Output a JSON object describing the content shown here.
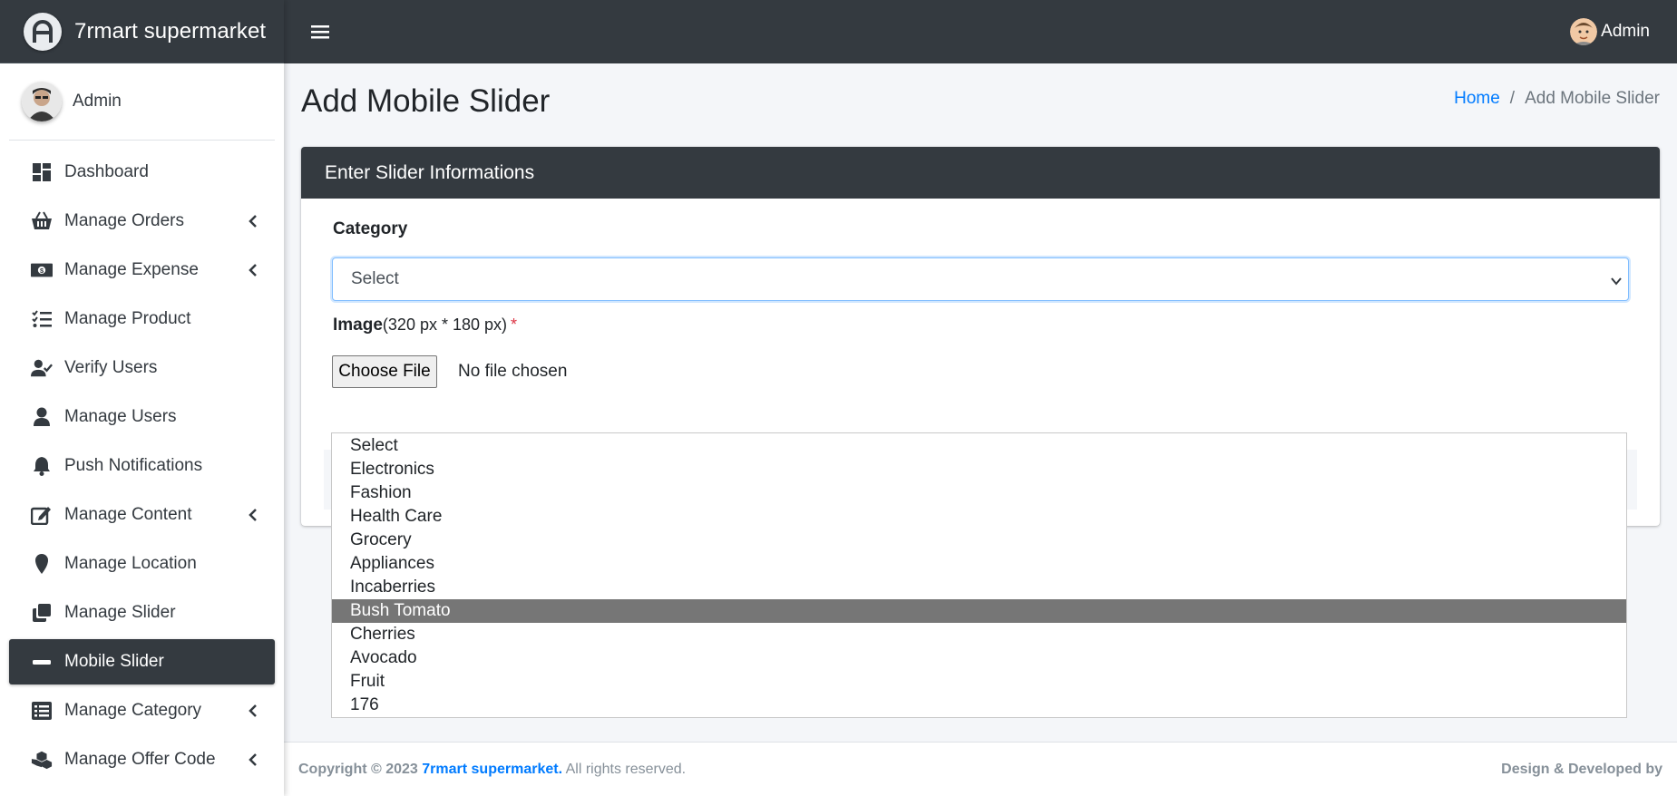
{
  "brand": {
    "name": "7rmart supermarket"
  },
  "sidebar": {
    "user_name": "Admin",
    "items": [
      {
        "label": "Dashboard",
        "icon": "dashboard-icon",
        "has_children": false,
        "active": false
      },
      {
        "label": "Manage Orders",
        "icon": "basket-icon",
        "has_children": true,
        "active": false
      },
      {
        "label": "Manage Expense",
        "icon": "money-icon",
        "has_children": true,
        "active": false
      },
      {
        "label": "Manage Product",
        "icon": "tasks-icon",
        "has_children": false,
        "active": false
      },
      {
        "label": "Verify Users",
        "icon": "user-check-icon",
        "has_children": false,
        "active": false
      },
      {
        "label": "Manage Users",
        "icon": "user-icon",
        "has_children": false,
        "active": false
      },
      {
        "label": "Push Notifications",
        "icon": "bell-icon",
        "has_children": false,
        "active": false
      },
      {
        "label": "Manage Content",
        "icon": "edit-icon",
        "has_children": true,
        "active": false
      },
      {
        "label": "Manage Location",
        "icon": "map-marker-icon",
        "has_children": false,
        "active": false
      },
      {
        "label": "Manage Slider",
        "icon": "clone-icon",
        "has_children": false,
        "active": false
      },
      {
        "label": "Mobile Slider",
        "icon": "minus-icon",
        "has_children": false,
        "active": true
      },
      {
        "label": "Manage Category",
        "icon": "list-alt-icon",
        "has_children": true,
        "active": false
      },
      {
        "label": "Manage Offer Code",
        "icon": "cubes-icon",
        "has_children": true,
        "active": false
      }
    ]
  },
  "topbar": {
    "user_label": "Admin"
  },
  "page": {
    "title": "Add Mobile Slider",
    "breadcrumb": {
      "home": "Home",
      "separator": "/",
      "current": "Add Mobile Slider"
    }
  },
  "card": {
    "header": "Enter Slider Informations",
    "category_label": "Category",
    "category_selected": "Select",
    "image_label": "Image",
    "image_hint": "(320 px * 180 px)",
    "required_mark": "*",
    "file_button": "Choose File",
    "file_status": "No file chosen"
  },
  "dropdown": {
    "options": [
      "Select",
      "Electronics",
      "Fashion",
      "Health Care",
      "Grocery",
      "Appliances",
      "Incaberries",
      "Bush Tomato",
      "Cherries",
      "Avocado",
      "Fruit",
      "176"
    ],
    "highlighted": "Bush Tomato"
  },
  "footer": {
    "copyright_prefix": "Copyright © 2023",
    "brand_link": "7rmart supermarket.",
    "rights": "All rights reserved.",
    "credit": "Design & Developed by"
  },
  "colors": {
    "dark": "#343a40",
    "link": "#007bff",
    "required": "#dc3545",
    "highlight": "#767676",
    "background": "#f4f6f9"
  }
}
